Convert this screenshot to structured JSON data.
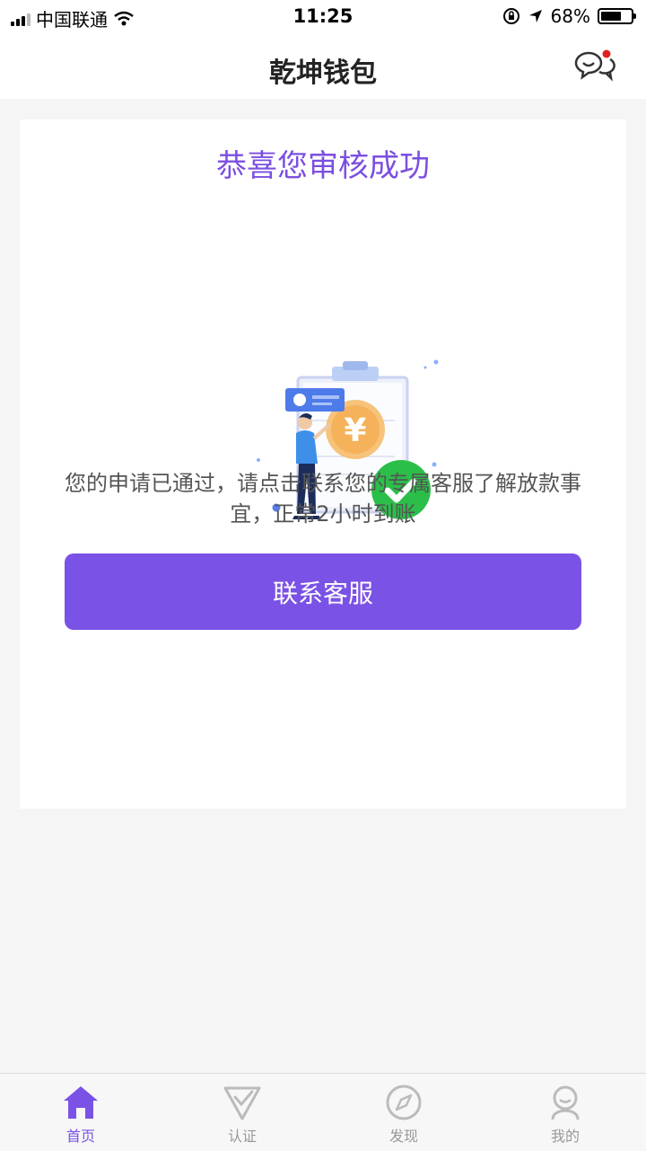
{
  "status_bar": {
    "carrier": "中国联通",
    "time": "11:25",
    "battery_percent": "68%",
    "battery_level": 0.68
  },
  "header": {
    "title": "乾坤钱包",
    "message_icon": "chat-bubbles-icon",
    "has_notification_dot": true
  },
  "card": {
    "title": "恭喜您审核成功",
    "illustration": "approved-clipboard-yuan-coin-icon",
    "message": "您的申请已通过，请点击联系您的专属客服了解放款事宜，正常2小时到账",
    "button_label": "联系客服"
  },
  "tabs": [
    {
      "label": "首页",
      "icon": "home-icon",
      "active": true
    },
    {
      "label": "认证",
      "icon": "check-shield-icon",
      "active": false
    },
    {
      "label": "发现",
      "icon": "compass-icon",
      "active": false
    },
    {
      "label": "我的",
      "icon": "user-icon",
      "active": false
    }
  ],
  "colors": {
    "accent": "#7b52e6",
    "title_purple": "#7b4fe0",
    "success_green": "#2bbf4a",
    "background": "#f5f5f5"
  }
}
